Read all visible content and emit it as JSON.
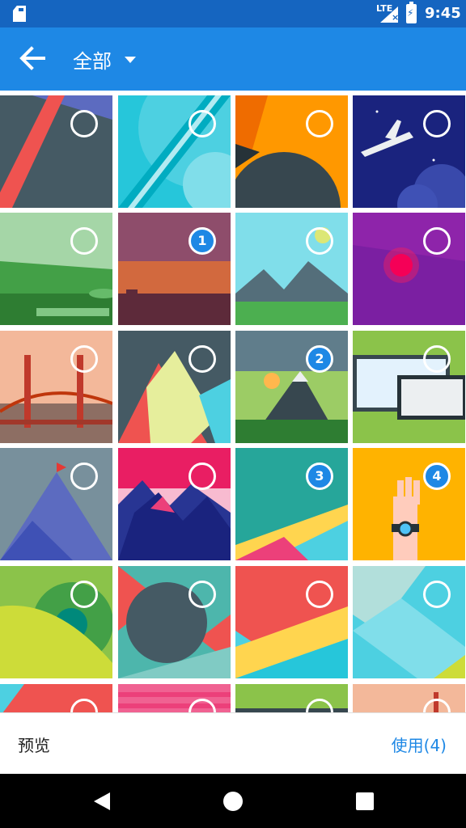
{
  "status_bar": {
    "network": "LTE",
    "time": "9:45"
  },
  "app_bar": {
    "title": "全部"
  },
  "grid": {
    "tiles": [
      {
        "name": "abstract-slate-diagonal",
        "sel": ""
      },
      {
        "name": "teal-circles-stripes",
        "sel": ""
      },
      {
        "name": "orange-dark-shapes",
        "sel": ""
      },
      {
        "name": "night-airplane",
        "sel": ""
      },
      {
        "name": "green-city-landscape",
        "sel": ""
      },
      {
        "name": "sunset-city-skyline",
        "sel": "1"
      },
      {
        "name": "mountain-lake-sun",
        "sel": ""
      },
      {
        "name": "purple-red-circle",
        "sel": ""
      },
      {
        "name": "golden-gate-bridge",
        "sel": ""
      },
      {
        "name": "layered-triangles",
        "sel": ""
      },
      {
        "name": "mountain-sun-valley",
        "sel": "2"
      },
      {
        "name": "tablet-devices",
        "sel": ""
      },
      {
        "name": "mountain-flag-peak",
        "sel": ""
      },
      {
        "name": "pink-mountains",
        "sel": ""
      },
      {
        "name": "teal-layers",
        "sel": "3"
      },
      {
        "name": "smartwatch-hand",
        "sel": "4"
      },
      {
        "name": "green-waves-circle",
        "sel": ""
      },
      {
        "name": "dark-circle-teal",
        "sel": ""
      },
      {
        "name": "red-teal-layers",
        "sel": ""
      },
      {
        "name": "light-teal-layers",
        "sel": ""
      },
      {
        "name": "partial-teal-red",
        "sel": ""
      },
      {
        "name": "partial-pink-stripes",
        "sel": ""
      },
      {
        "name": "partial-green-dark",
        "sel": ""
      },
      {
        "name": "partial-bridge",
        "sel": ""
      }
    ]
  },
  "bottom_bar": {
    "preview_label": "预览",
    "use_label": "使用(4)"
  },
  "colors": {
    "app_bar": "#1e88e5",
    "status_bar": "#1565c0",
    "accent": "#1e88e5"
  }
}
